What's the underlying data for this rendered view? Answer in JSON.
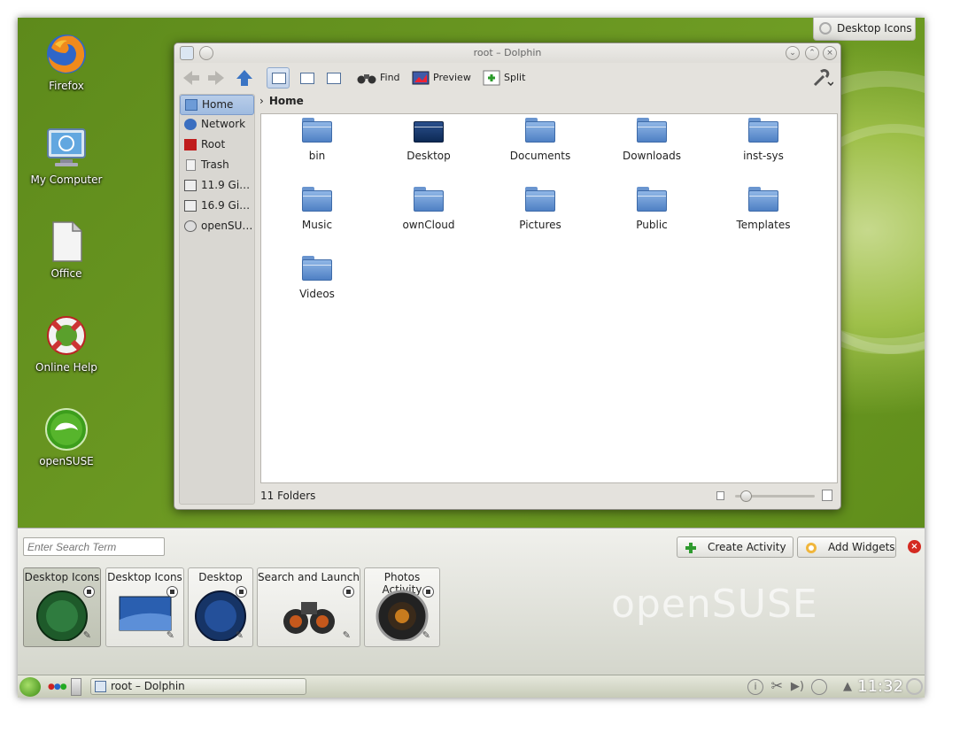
{
  "desktop": {
    "icons": [
      {
        "label": "Firefox"
      },
      {
        "label": "My Computer"
      },
      {
        "label": "Office"
      },
      {
        "label": "Online Help"
      },
      {
        "label": "openSUSE"
      }
    ],
    "toolbox_label": "Desktop Icons"
  },
  "window": {
    "title": "root – Dolphin",
    "toolbar": {
      "find": "Find",
      "preview": "Preview",
      "split": "Split"
    },
    "places": [
      {
        "label": "Home"
      },
      {
        "label": "Network"
      },
      {
        "label": "Root"
      },
      {
        "label": "Trash"
      },
      {
        "label": "11.9 GiB…"
      },
      {
        "label": "16.9 GiB…"
      },
      {
        "label": "openSU…"
      }
    ],
    "breadcrumb": "Home",
    "folders": [
      {
        "name": "bin"
      },
      {
        "name": "Desktop"
      },
      {
        "name": "Documents"
      },
      {
        "name": "Downloads"
      },
      {
        "name": "inst-sys"
      },
      {
        "name": "Music"
      },
      {
        "name": "ownCloud"
      },
      {
        "name": "Pictures"
      },
      {
        "name": "Public"
      },
      {
        "name": "Templates"
      },
      {
        "name": "Videos"
      }
    ],
    "status": "11 Folders"
  },
  "activity_bar": {
    "search_placeholder": "Enter Search Term",
    "create_activity": "Create Activity",
    "add_widgets": "Add Widgets",
    "brand": "openSUSE",
    "activities": [
      {
        "label": "Desktop Icons"
      },
      {
        "label": "Desktop Icons"
      },
      {
        "label": "Desktop"
      },
      {
        "label": "Search and Launch"
      },
      {
        "label": "Photos Activity"
      }
    ]
  },
  "taskbar": {
    "task_label": "root – Dolphin",
    "clock": "11:32"
  }
}
